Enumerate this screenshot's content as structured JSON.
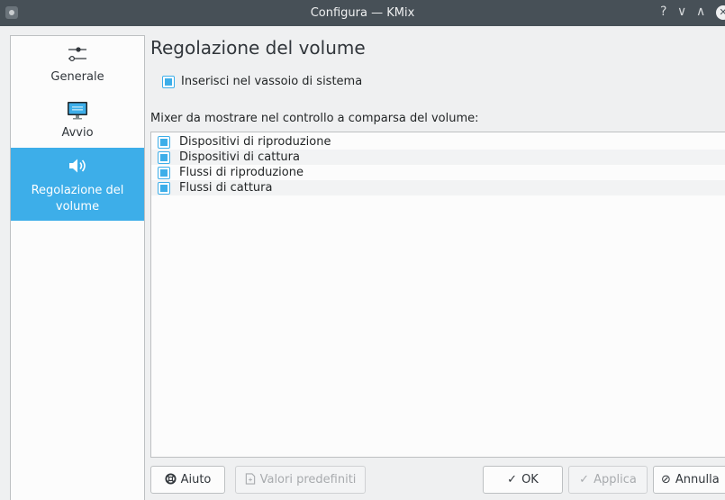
{
  "window": {
    "title": "Configura — KMix",
    "help_glyph": "?",
    "minimize_glyph": "∨",
    "maximize_glyph": "∧",
    "close_glyph": "✕"
  },
  "sidebar": {
    "items": [
      {
        "label": "Generale",
        "icon": "slider-icon"
      },
      {
        "label": "Avvio",
        "icon": "monitor-icon"
      },
      {
        "label": "Regolazione del volume",
        "icon": "speaker-icon",
        "active": true
      }
    ]
  },
  "page": {
    "title": "Regolazione del volume",
    "tray_checkbox_label": "Inserisci nel vassoio di sistema",
    "mixer_list_label": "Mixer da mostrare nel controllo a comparsa del volume:",
    "mixers": [
      {
        "label": "Dispositivi di riproduzione",
        "checked": true
      },
      {
        "label": "Dispositivi di cattura",
        "checked": true
      },
      {
        "label": "Flussi di riproduzione",
        "checked": true
      },
      {
        "label": "Flussi di cattura",
        "checked": true
      }
    ]
  },
  "buttons": {
    "help": "Aiuto",
    "defaults": "Valori predefiniti",
    "ok": "OK",
    "apply": "Applica",
    "cancel": "Annulla"
  },
  "colors": {
    "accent": "#3daee9",
    "titlebar": "#475057",
    "window_bg": "#eff0f1"
  }
}
